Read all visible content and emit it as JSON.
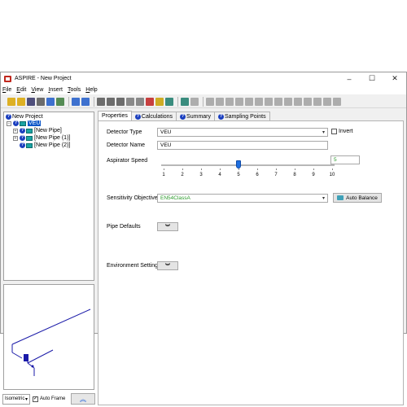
{
  "window": {
    "title": "ASPIRE - New Project",
    "controls": [
      "–",
      "☐",
      "✕"
    ]
  },
  "menu": [
    {
      "label": "File",
      "mnemonic": "F",
      "rest": "ile"
    },
    {
      "label": "Edit",
      "mnemonic": "E",
      "rest": "dit"
    },
    {
      "label": "View",
      "mnemonic": "V",
      "rest": "iew"
    },
    {
      "label": "Insert",
      "mnemonic": "I",
      "rest": "nsert"
    },
    {
      "label": "Tools",
      "mnemonic": "T",
      "rest": "ools"
    },
    {
      "label": "Help",
      "mnemonic": "H",
      "rest": "elp"
    }
  ],
  "toolbar": {
    "icons": [
      "new-icon",
      "open-icon",
      "save-icon",
      "print-icon",
      "dollar-icon",
      "checklist-icon",
      "undo-icon",
      "redo-icon",
      "cut-icon",
      "copy-icon",
      "paste-icon",
      "arrow-icon",
      "arrow-icon",
      "delete-icon",
      "tag-icon",
      "device-icon",
      "grid-icon",
      "pipe-icon",
      "pipe-icon",
      "pipe-icon",
      "pipe-icon",
      "pipe-icon",
      "pipe-icon",
      "pipe-icon",
      "pipe-icon",
      "pipe-icon",
      "pipe-icon",
      "pipe-icon",
      "pipe-icon",
      "pipe-icon",
      "pipe-icon",
      "pipe-icon"
    ],
    "colors": [
      "#d9a400",
      "#d9a400",
      "#333366",
      "#555555",
      "#1f5bc9",
      "#3a7a3a",
      "#1f5bc9",
      "#1f5bc9",
      "#555555",
      "#555555",
      "#555555",
      "#777777",
      "#777777",
      "#c02020",
      "#c8a000",
      "#1a7a6a",
      "#1a7a6a",
      "#777777",
      "#777777",
      "#777777",
      "#777777",
      "#777777",
      "#777777",
      "#777777",
      "#777777",
      "#777777",
      "#777777",
      "#777777",
      "#777777",
      "#777777",
      "#777777",
      "#777777"
    ]
  },
  "tree": {
    "root": "New Project",
    "detector": "VEU",
    "pipes": [
      "[New Pipe]",
      "[New Pipe (1)]",
      "[New Pipe (2)]"
    ]
  },
  "preview": {
    "view_mode": "Isometric",
    "auto_frame_label": "Auto Frame",
    "auto_frame_checked": true,
    "collapse_icon": "︽"
  },
  "tabs": [
    "Properties",
    "Calculations",
    "Summary",
    "Sampling Points"
  ],
  "properties": {
    "detector_type_label": "Detector Type",
    "detector_type_value": "VEU",
    "invert_label": "Invert",
    "invert_checked": false,
    "detector_name_label": "Detector Name",
    "detector_name_value": "VEU",
    "aspirator_speed_label": "Aspirator Speed",
    "aspirator_speed_value": "5",
    "aspirator_speed_ticks": [
      "1",
      "2",
      "3",
      "4",
      "5",
      "6",
      "7",
      "8",
      "9",
      "10"
    ],
    "sensitivity_label": "Sensitivity Objective",
    "sensitivity_value": "EN54ClassA",
    "auto_balance_label": "Auto Balance",
    "pipe_defaults_label": "Pipe Defaults",
    "environment_label": "Environment Settings",
    "expand_icon": "︾"
  },
  "colors": {
    "accent": "#1f6fe0",
    "selection": "#0a56c8",
    "green_value": "#2a9a2a",
    "pipe_line": "#1a1aa8"
  }
}
